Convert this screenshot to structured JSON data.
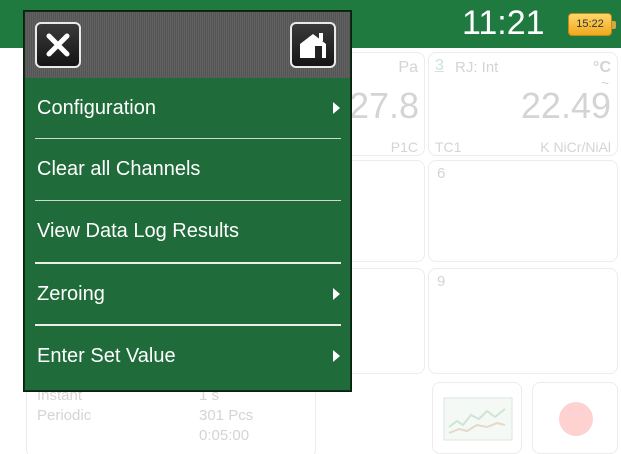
{
  "status_bar": {
    "time": "11:21",
    "battery_text": "15:22"
  },
  "background": {
    "channel_top_mid": {
      "unit": "Pa",
      "value": "27.8",
      "label": "P1C"
    },
    "channel_top_right": {
      "index": "3",
      "rj": "RJ: Int",
      "unit": "°C",
      "tilde": "~",
      "value": "22.49",
      "label_left": "TC1",
      "label_right": "K  NiCr/NiAl"
    },
    "channel_mid_right": {
      "index": "6"
    },
    "channel_low_right": {
      "index": "9"
    },
    "log_info": {
      "row1_label": "Instant",
      "row1_value": "1 s",
      "row2_label": "Periodic",
      "row2_value": "301 Pcs",
      "row3_value": "0:05:00"
    }
  },
  "menu": {
    "items": [
      {
        "label": "Configuration",
        "submenu": true
      },
      {
        "label": "Clear all Channels",
        "submenu": false
      },
      {
        "label": "View Data Log Results",
        "submenu": false
      },
      {
        "label": "Zeroing",
        "submenu": true
      },
      {
        "label": "Enter Set Value",
        "submenu": true
      }
    ]
  },
  "icons": {
    "close": "close-icon",
    "home": "home-icon",
    "chart": "chart-icon",
    "record": "record-icon"
  },
  "colors": {
    "accent_green": "#1e7a3f",
    "menu_green": "#1f6b3a",
    "battery": "#f0a81c",
    "record_red": "#ff5a5a"
  }
}
